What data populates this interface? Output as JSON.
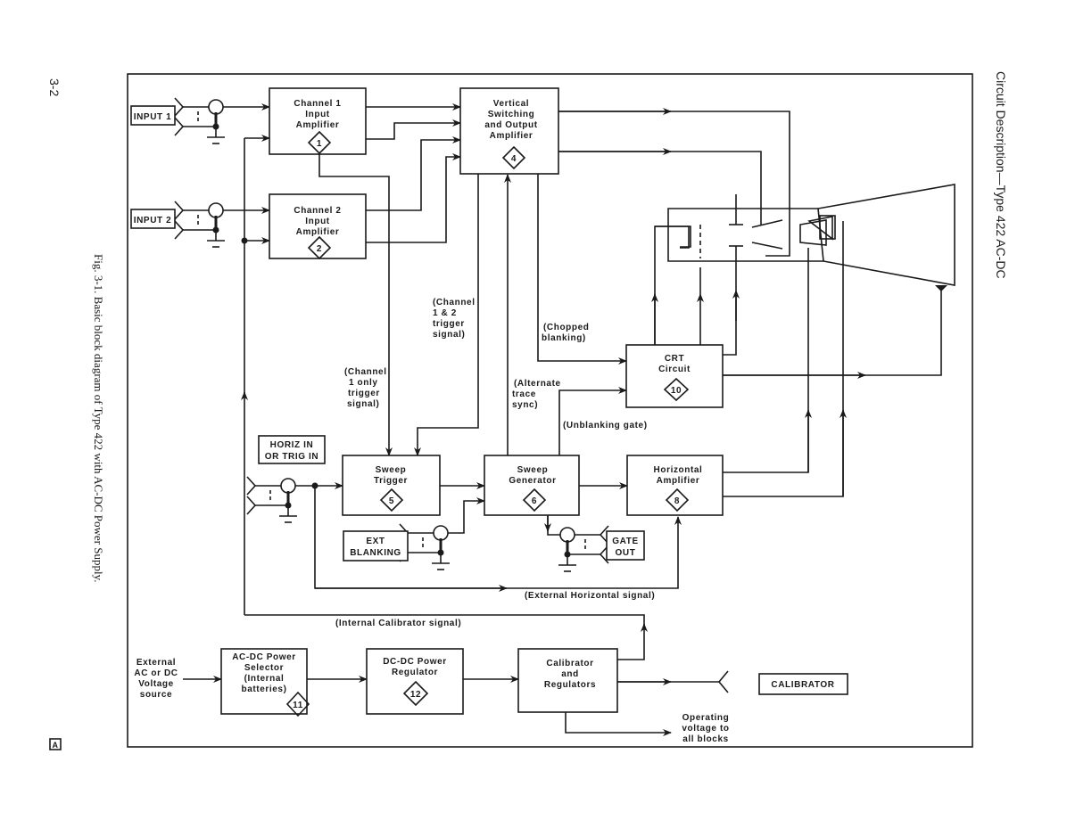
{
  "page": {
    "number": "3-2",
    "header": "Circuit Description—Type 422 AC-DC",
    "caption": "Fig. 3-1. Basic block diagram of Type 422 with AC-DC Power Supply.",
    "edition_mark": "A"
  },
  "connectors": {
    "input1": "INPUT 1",
    "input2": "INPUT 2",
    "horiz_in": [
      "HORIZ IN",
      "OR TRIG IN"
    ],
    "ext_blanking": [
      "EXT",
      "BLANKING"
    ],
    "gate_out": [
      "GATE",
      "OUT"
    ],
    "calibrator": "CALIBRATOR"
  },
  "blocks": {
    "ch1": {
      "lines": [
        "Channel 1",
        "Input",
        "Amplifier"
      ],
      "num": "1"
    },
    "ch2": {
      "lines": [
        "Channel 2",
        "Input",
        "Amplifier"
      ],
      "num": "2"
    },
    "vert": {
      "lines": [
        "Vertical",
        "Switching",
        "and Output",
        "Amplifier"
      ],
      "num": "4"
    },
    "trig": {
      "lines": [
        "Sweep",
        "Trigger"
      ],
      "num": "5"
    },
    "gen": {
      "lines": [
        "Sweep",
        "Generator"
      ],
      "num": "6"
    },
    "horiz": {
      "lines": [
        "Horizontal",
        "Amplifier"
      ],
      "num": "8"
    },
    "crt": {
      "lines": [
        "CRT",
        "Circuit"
      ],
      "num": "10"
    },
    "acdc": {
      "lines": [
        "AC-DC Power",
        "Selector",
        "(Internal",
        "batteries)"
      ],
      "num": "11"
    },
    "dcdc": {
      "lines": [
        "DC-DC Power",
        "Regulator"
      ],
      "num": "12"
    },
    "cal": {
      "lines": [
        "Calibrator",
        "and",
        "Regulators"
      ]
    }
  },
  "signals": {
    "ch12_trig": [
      "(Channel",
      "1 & 2",
      "trigger",
      "signal)"
    ],
    "ch1_trig": [
      "(Channel",
      "1 only",
      "trigger",
      "signal)"
    ],
    "chopped": [
      "(Chopped",
      "blanking)"
    ],
    "alt": [
      "(Alternate",
      "trace",
      "sync)"
    ],
    "unblank": "(Unblanking gate)",
    "ext_horiz": "(External Horizontal signal)",
    "int_cal": "(Internal Calibrator signal)",
    "ext_source": [
      "External",
      "AC or DC",
      "Voltage",
      "source"
    ],
    "operating": [
      "Operating",
      "voltage to",
      "all blocks"
    ]
  }
}
